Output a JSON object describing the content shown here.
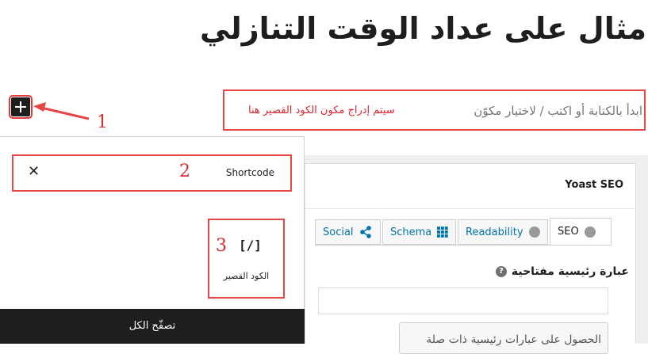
{
  "page": {
    "title": "مثال على عداد الوقت التنازلي"
  },
  "inserter_toggle": {
    "icon": "plus-icon"
  },
  "annotations": {
    "n1": "1",
    "n2": "2",
    "n3": "3"
  },
  "appender": {
    "placeholder": "ابدأ بالكتابة أو اكتب / لاختيار مكوّن",
    "note": "سيتم إدراج مكون الكود القصير هنا"
  },
  "inserter": {
    "search_value": "Shortcode",
    "clear_icon": "close-icon",
    "block": {
      "icon_text": "[/]",
      "label": "الكود القصير"
    },
    "browse_all": "تصفّح الكل"
  },
  "yoast": {
    "title": "Yoast SEO",
    "tabs": [
      {
        "label": "SEO",
        "icon": "status-dot-icon"
      },
      {
        "label": "Readability",
        "icon": "status-dot-icon"
      },
      {
        "label": "Schema",
        "icon": "grid-icon"
      },
      {
        "label": "Social",
        "icon": "share-icon"
      }
    ],
    "keyphrase_label": "عبارة رئيسية مفتاحية",
    "keyphrase_value": "",
    "related_button": "الحصول على عبارات رئيسية ذات صلة"
  },
  "colors": {
    "annotation_red": "#e64646",
    "tab_link": "#0073aa",
    "dark": "#1e1e1e"
  }
}
